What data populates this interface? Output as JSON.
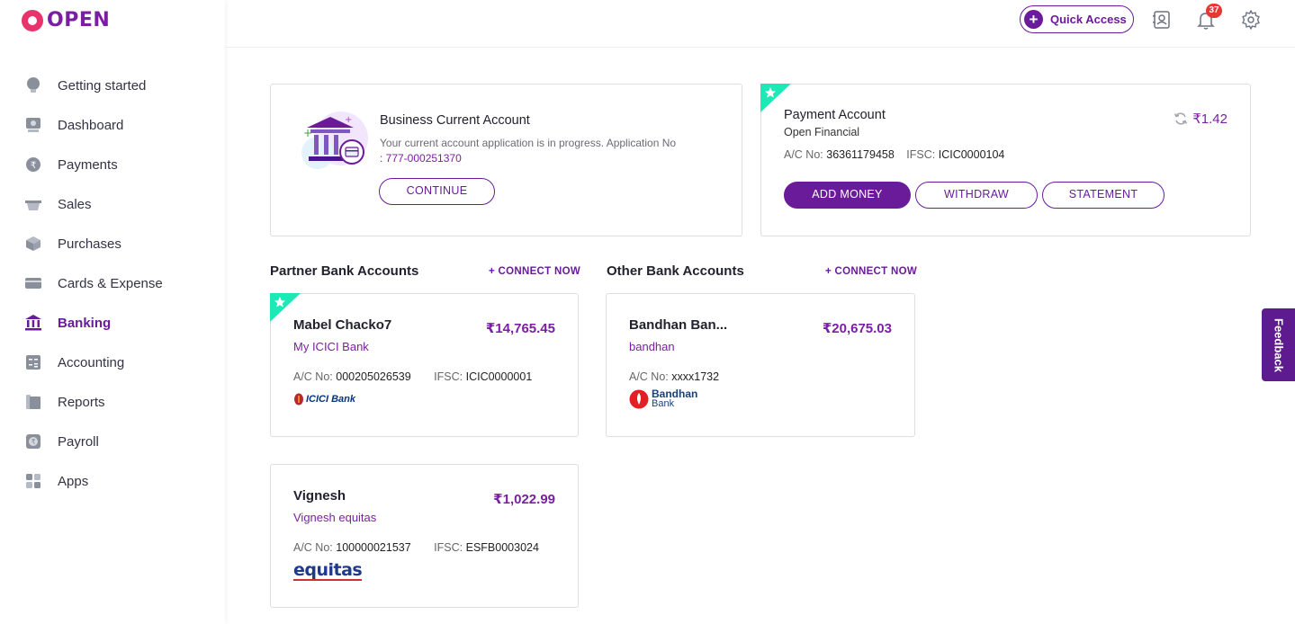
{
  "app": {
    "logo_text": "OPEN"
  },
  "sidebar": {
    "items": [
      {
        "label": "Getting started",
        "icon": "bulb-icon"
      },
      {
        "label": "Dashboard",
        "icon": "dashboard-icon"
      },
      {
        "label": "Payments",
        "icon": "payments-icon"
      },
      {
        "label": "Sales",
        "icon": "basket-icon"
      },
      {
        "label": "Purchases",
        "icon": "box-icon"
      },
      {
        "label": "Cards & Expense",
        "icon": "card-icon"
      },
      {
        "label": "Banking",
        "icon": "bank-icon",
        "active": true
      },
      {
        "label": "Accounting",
        "icon": "calculator-icon"
      },
      {
        "label": "Reports",
        "icon": "reports-icon"
      },
      {
        "label": "Payroll",
        "icon": "payroll-icon"
      },
      {
        "label": "Apps",
        "icon": "apps-icon"
      }
    ]
  },
  "header": {
    "quick_access_label": "Quick Access",
    "notification_count": "37"
  },
  "business_account": {
    "title": "Business Current Account",
    "message": "Your current account application is in progress. Application No",
    "app_no": ": 777-000251370",
    "continue_label": "CONTINUE"
  },
  "payment_account": {
    "title": "Payment Account",
    "provider": "Open Financial",
    "balance": "₹1.42",
    "ac_label": "A/C No:",
    "ac_no": "36361179458",
    "ifsc_label": "IFSC:",
    "ifsc": "ICIC0000104",
    "add_money_label": "ADD MONEY",
    "withdraw_label": "WITHDRAW",
    "statement_label": "STATEMENT"
  },
  "partner_section": {
    "title": "Partner Bank Accounts",
    "connect_label": "+ CONNECT NOW"
  },
  "other_section": {
    "title": "Other Bank Accounts",
    "connect_label": "+ CONNECT NOW"
  },
  "partner_accounts": [
    {
      "name": "Mabel Chacko7",
      "bank": "My ICICI Bank",
      "amount": "₹14,765.45",
      "ac_label": "A/C No:",
      "ac_no": "000205026539",
      "ifsc_label": "IFSC:",
      "ifsc": "ICIC0000001",
      "logo_text": "ICICI Bank"
    },
    {
      "name": "Vignesh",
      "bank": "Vignesh equitas",
      "amount": "₹1,022.99",
      "ac_label": "A/C No:",
      "ac_no": "100000021537",
      "ifsc_label": "IFSC:",
      "ifsc": "ESFB0003024",
      "logo_text": "equitas"
    }
  ],
  "other_accounts": [
    {
      "name": "Bandhan Ban...",
      "bank": "bandhan",
      "amount": "₹20,675.03",
      "ac_label": "A/C No:",
      "ac_no": "xxxx1732",
      "logo_text_1": "Bandhan",
      "logo_text_2": "Bank"
    }
  ],
  "feedback_label": "Feedback",
  "colors": {
    "brand": "#6a1b9a",
    "accent_green": "#1de9b6",
    "logo_pink": "#e8336b"
  }
}
